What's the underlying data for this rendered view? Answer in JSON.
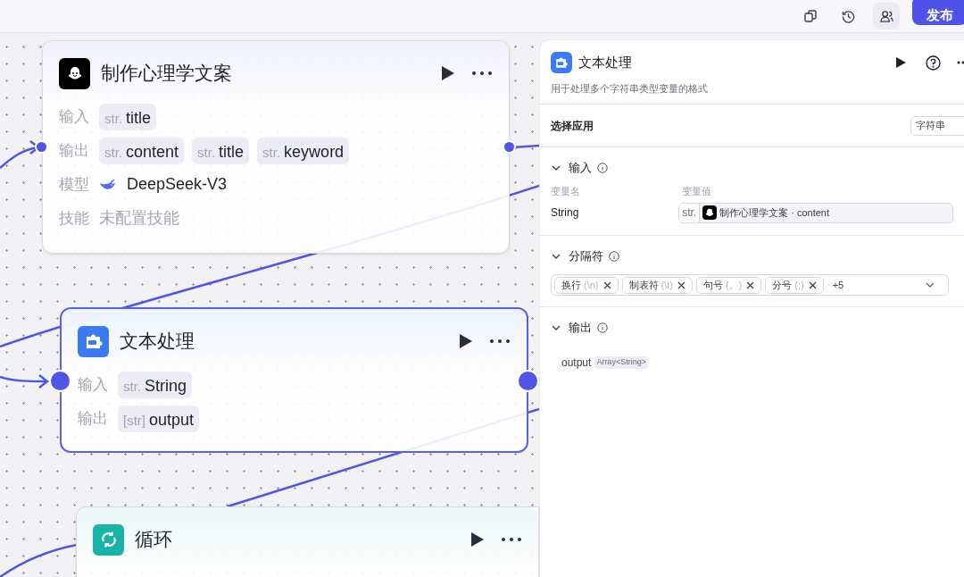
{
  "toolbar": {
    "publish_button": "发布"
  },
  "nodes": [
    {
      "kind": "llm",
      "title": "制作心理学文案",
      "selected": false,
      "rows": [
        {
          "label": "输入",
          "kind": "vars",
          "vars": [
            {
              "type": "str.",
              "name": "title"
            }
          ]
        },
        {
          "label": "输出",
          "kind": "vars",
          "vars": [
            {
              "type": "str.",
              "name": "content"
            },
            {
              "type": "str.",
              "name": "title"
            },
            {
              "type": "str.",
              "name": "keyword"
            }
          ]
        },
        {
          "label": "模型",
          "kind": "model",
          "value": "DeepSeek-V3"
        },
        {
          "label": "技能",
          "kind": "empty",
          "value": "未配置技能"
        }
      ]
    },
    {
      "kind": "text",
      "title": "文本处理",
      "selected": true,
      "rows": [
        {
          "label": "输入",
          "kind": "vars",
          "vars": [
            {
              "type": "str.",
              "name": "String"
            }
          ]
        },
        {
          "label": "输出",
          "kind": "vars",
          "vars": [
            {
              "type": "[str]",
              "name": "output"
            }
          ]
        }
      ]
    },
    {
      "kind": "loop",
      "title": "循环",
      "selected": false
    }
  ],
  "panel": {
    "title": "文本处理",
    "description": "用于处理多个字符串类型变量的格式",
    "app_select": {
      "label": "选择应用",
      "value": "字符串"
    },
    "input": {
      "heading": "输入",
      "expanded": true,
      "columns": [
        "变量名",
        "变量值"
      ],
      "rows": [
        {
          "name": "String",
          "type": "str.",
          "source": "制作心理学文案 · content"
        }
      ]
    },
    "separator": {
      "heading": "分隔符",
      "expanded": true,
      "tags": [
        {
          "label": "换行",
          "hint": "(\\n)"
        },
        {
          "label": "制表符",
          "hint": "(\\t)"
        },
        {
          "label": "句号",
          "hint": "(。)"
        },
        {
          "label": "分号",
          "hint": "(;)"
        }
      ],
      "more": "+5"
    },
    "output": {
      "heading": "输出",
      "expanded": true,
      "name": "output",
      "type": "Array<String>"
    }
  }
}
